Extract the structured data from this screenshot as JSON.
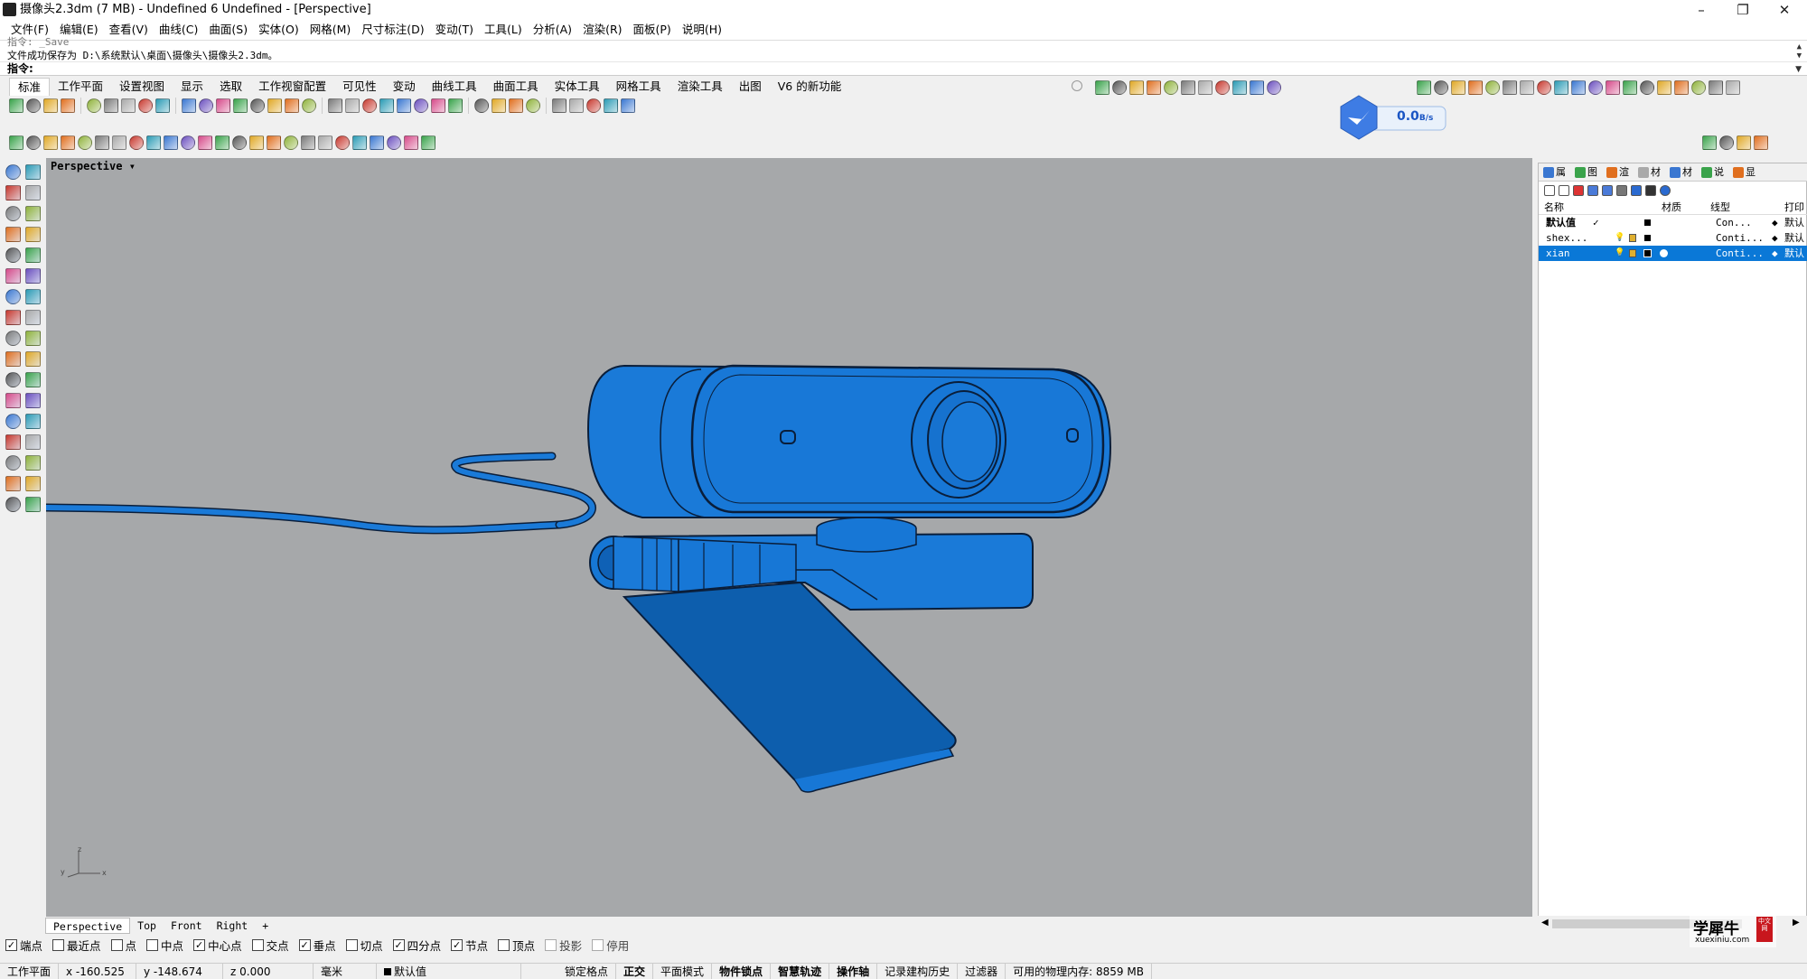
{
  "window": {
    "title": "摄像头2.3dm (7 MB) - Undefined 6 Undefined - [Perspective]",
    "minimize": "–",
    "maximize": "❐",
    "close": "✕"
  },
  "menu": [
    "文件(F)",
    "编辑(E)",
    "查看(V)",
    "曲线(C)",
    "曲面(S)",
    "实体(O)",
    "网格(M)",
    "尺寸标注(D)",
    "变动(T)",
    "工具(L)",
    "分析(A)",
    "渲染(R)",
    "面板(P)",
    "说明(H)"
  ],
  "command": {
    "history_line1": "指令: _Save",
    "history_line2": "文件成功保存为 D:\\系统默认\\桌面\\摄像头\\摄像头2.3dm。",
    "prompt": "指令:"
  },
  "toolbar_tabs": [
    "标准",
    "工作平面",
    "设置视图",
    "显示",
    "选取",
    "工作视窗配置",
    "可见性",
    "变动",
    "曲线工具",
    "曲面工具",
    "实体工具",
    "网格工具",
    "渲染工具",
    "出图",
    "V6 的新功能"
  ],
  "active_tab": "标准",
  "network_widget": {
    "value": "0.0",
    "unit": "B/s"
  },
  "viewport": {
    "label": "Perspective",
    "axes": {
      "x": "x",
      "y": "y",
      "z": "z"
    },
    "bg_color": "#a6a8aa",
    "model_color": "#1777d6"
  },
  "viewport_tabs": [
    "Perspective",
    "Top",
    "Front",
    "Right"
  ],
  "add_viewport": "+",
  "panel": {
    "tabs": [
      "属",
      "图",
      "渲",
      "材",
      "材",
      "说",
      "显"
    ],
    "headers": {
      "name": "名称",
      "material": "材质",
      "linetype": "线型",
      "print": "打印"
    },
    "layers": [
      {
        "name": "默认值",
        "current": "✓",
        "linetype": "Con...",
        "print": "默认",
        "selected": false,
        "bold": true
      },
      {
        "name": "shex...",
        "current": "",
        "linetype": "Conti...",
        "print": "默认",
        "selected": false,
        "bold": false
      },
      {
        "name": "xian",
        "current": "",
        "linetype": "Conti...",
        "print": "默认",
        "selected": true,
        "bold": false
      }
    ]
  },
  "osnaps": [
    {
      "label": "端点",
      "checked": true,
      "disabled": false
    },
    {
      "label": "最近点",
      "checked": false,
      "disabled": false
    },
    {
      "label": "点",
      "checked": false,
      "disabled": false
    },
    {
      "label": "中点",
      "checked": false,
      "disabled": false
    },
    {
      "label": "中心点",
      "checked": true,
      "disabled": false
    },
    {
      "label": "交点",
      "checked": false,
      "disabled": false
    },
    {
      "label": "垂点",
      "checked": true,
      "disabled": false
    },
    {
      "label": "切点",
      "checked": false,
      "disabled": false
    },
    {
      "label": "四分点",
      "checked": true,
      "disabled": false
    },
    {
      "label": "节点",
      "checked": true,
      "disabled": false
    },
    {
      "label": "顶点",
      "checked": false,
      "disabled": false
    },
    {
      "label": "投影",
      "checked": false,
      "disabled": true
    },
    {
      "label": "停用",
      "checked": false,
      "disabled": true
    }
  ],
  "status": {
    "cplane": "工作平面",
    "x": "x -160.525",
    "y": "y -148.674",
    "z": "z 0.000",
    "units": "毫米",
    "layer": "默认值",
    "toggles": [
      {
        "label": "锁定格点",
        "bold": false
      },
      {
        "label": "正交",
        "bold": true
      },
      {
        "label": "平面模式",
        "bold": false
      },
      {
        "label": "物件锁点",
        "bold": true
      },
      {
        "label": "智慧轨迹",
        "bold": true
      },
      {
        "label": "操作轴",
        "bold": true
      },
      {
        "label": "记录建构历史",
        "bold": false
      },
      {
        "label": "过滤器",
        "bold": false
      }
    ],
    "memory": "可用的物理内存: 8859 MB"
  },
  "watermark": {
    "brand": "学犀牛",
    "url": "xuexiniu.com",
    "badge": "中文网"
  },
  "colors": {
    "selection": "#0a78d7",
    "model_fill": "#1777d6",
    "model_dark": "#0c57a8",
    "outline": "#0a1e3a"
  }
}
